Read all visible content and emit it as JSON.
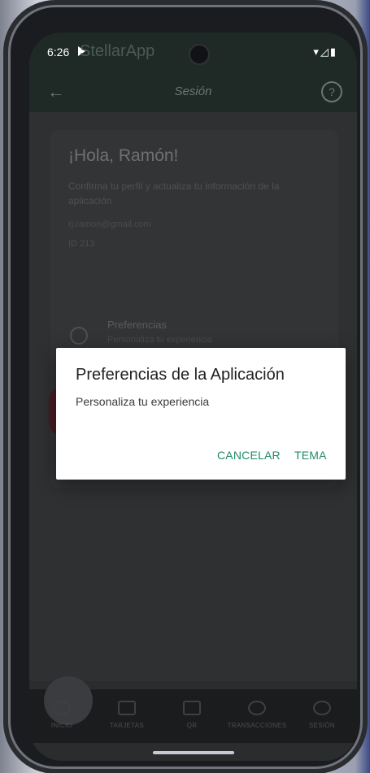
{
  "status": {
    "time": "6:26",
    "app_name": "StellarApp",
    "icons": "▾◿▮"
  },
  "appbar": {
    "title": "Sesión",
    "back": "←",
    "help": "?"
  },
  "card": {
    "greeting": "¡Hola, Ramón!",
    "subtitle": "Confirma tu perfil y actualiza tu información de la aplicación",
    "line1": "rj.ramon@gmail.com",
    "line2": "ID 213",
    "pref_title": "Preferencias",
    "pref_subtitle": "Personaliza tu experiencia"
  },
  "dialog": {
    "title": "Preferencias de la Aplicación",
    "message": "Personaliza tu experiencia",
    "cancel": "CANCELAR",
    "theme": "TEMA"
  },
  "nav": [
    {
      "label": "INICIO"
    },
    {
      "label": "TARJETAS"
    },
    {
      "label": "QR"
    },
    {
      "label": "TRANSACCIONES"
    },
    {
      "label": "SESIÓN"
    }
  ],
  "colors": {
    "accent": "#1f8a6a",
    "dialog_bg": "#ffffff",
    "scrim": "#2f3032"
  }
}
